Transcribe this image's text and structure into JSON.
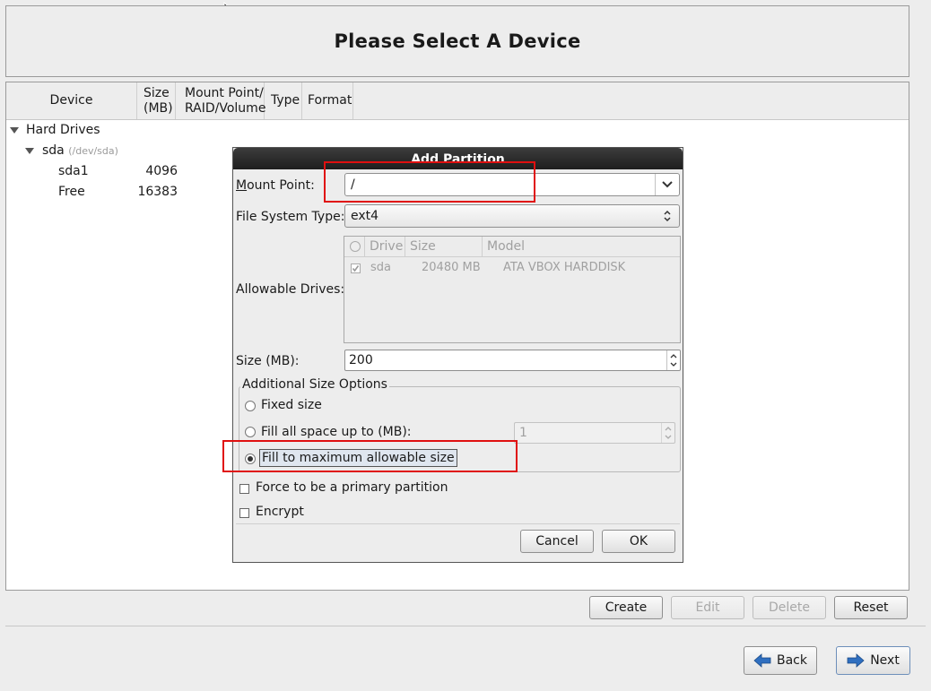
{
  "header": {
    "title": "Please Select A Device"
  },
  "columns": [
    "Device",
    "Size\n(MB)",
    "Mount Point/\nRAID/Volume",
    "Type",
    "Format"
  ],
  "tree": {
    "group": "Hard Drives",
    "disk": {
      "name": "sda",
      "path": "(/dev/sda)"
    },
    "partitions": [
      {
        "name": "sda1",
        "size": "4096"
      },
      {
        "name": "Free",
        "size": "16383"
      }
    ]
  },
  "dialog": {
    "title": "Add Partition",
    "mount_point_label": "Mount Point:",
    "mount_point_value": "/",
    "fs_type_label": "File System Type:",
    "fs_type_value": "ext4",
    "allowable_drives_label": "Allowable Drives:",
    "drives_headers": [
      "Drive",
      "Size",
      "Model"
    ],
    "drives": [
      {
        "drive": "sda",
        "size": "20480 MB",
        "model": "ATA VBOX HARDDISK",
        "checked": true
      }
    ],
    "size_label": "Size (MB):",
    "size_value": "200",
    "additional_options_title": "Additional Size Options",
    "opt_fixed": "Fixed size",
    "opt_fill_upto": "Fill all space up to (MB):",
    "opt_fill_upto_value": "1",
    "opt_fill_max": "Fill to maximum allowable size",
    "selected_option": "Fill to maximum allowable size",
    "force_primary_label": "Force to be a primary partition",
    "encrypt_label": "Encrypt",
    "cancel_label": "Cancel",
    "ok_label": "OK"
  },
  "actions": {
    "create": "Create",
    "edit": "Edit",
    "delete": "Delete",
    "reset": "Reset"
  },
  "nav": {
    "back": "Back",
    "next": "Next"
  },
  "colors": {
    "highlight": "#e01010",
    "nav_arrow": "#2f6fc0"
  }
}
